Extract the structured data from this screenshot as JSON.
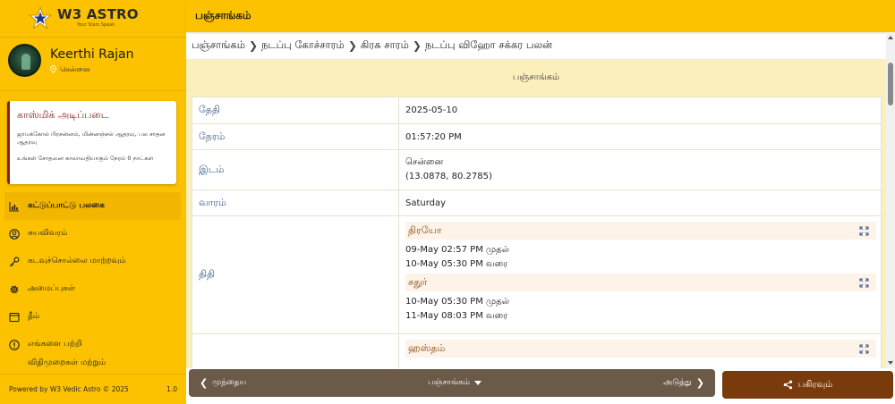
{
  "app": {
    "logo_text": "W3 ASTRO",
    "tagline": "Your Stars Speak"
  },
  "profile": {
    "name": "Keerthi Rajan",
    "location": "சென்னை"
  },
  "card": {
    "title": "காஸ்மிக் அடிப்படை",
    "line1": "ஜாமக்கோல் பிரசன்னம், மின்னஞ்சல் ஆதரவு, பல சாதன ஆதரவு",
    "line2": "உங்கள் சோதனை காலாவதியாகும் நேரம் 0 நாட்கள்"
  },
  "nav": [
    {
      "label": "கட்டுப்பாட்டு பலகை",
      "active": true
    },
    {
      "label": "சுயவிவரம்"
    },
    {
      "label": "கடவுச்சொல்லை மாற்றவும்"
    },
    {
      "label": "அமைப்புகள்"
    },
    {
      "label": "தீம்"
    },
    {
      "label": "எங்களை பற்றி"
    },
    {
      "label": "விதிமுறைகள் மற்றும்"
    }
  ],
  "footer": {
    "powered": "Powered by W3 Vedic Astro © 2025",
    "version": "1.0"
  },
  "header": {
    "title": "பஞ்சாங்கம்"
  },
  "breadcrumb": [
    "பஞ்சாங்கம்",
    "நடப்பு கோச்சாரம்",
    "கிரக சாரம்",
    "நடப்பு விஹோ சக்கர பலன்"
  ],
  "content": {
    "title": "பஞ்சாங்கம்",
    "rows": {
      "date": {
        "label": "தேதி",
        "value": "2025-05-10"
      },
      "time": {
        "label": "நேரம்",
        "value": "01:57:20 PM"
      },
      "place": {
        "label": "இடம்",
        "value": "சென்னை",
        "coords": "(13.0878, 80.2785)"
      },
      "weekday": {
        "label": "வாரம்",
        "value": "Saturday"
      },
      "tithi": {
        "label": "திதி",
        "items": [
          {
            "name": "திரயோ",
            "from": "09-May 02:57 PM முதல்",
            "to": "10-May 05:30 PM வரை"
          },
          {
            "name": "சதுர்",
            "from": "10-May 05:30 PM முதல்",
            "to": "11-May 08:03 PM வரை"
          }
        ]
      },
      "nakshatra": {
        "name": "ஹஸ்தம்"
      }
    }
  },
  "bottom_nav": {
    "prev": "முந்தைய",
    "current": "பஞ்சாங்கம்",
    "next": "அடுத்து",
    "share": "பகிரவும்"
  },
  "colors": {
    "primary": "#fcc200",
    "accent": "#7a3b0c",
    "nav_bar": "#6b5a48",
    "label_blue": "#3a5a8c"
  }
}
